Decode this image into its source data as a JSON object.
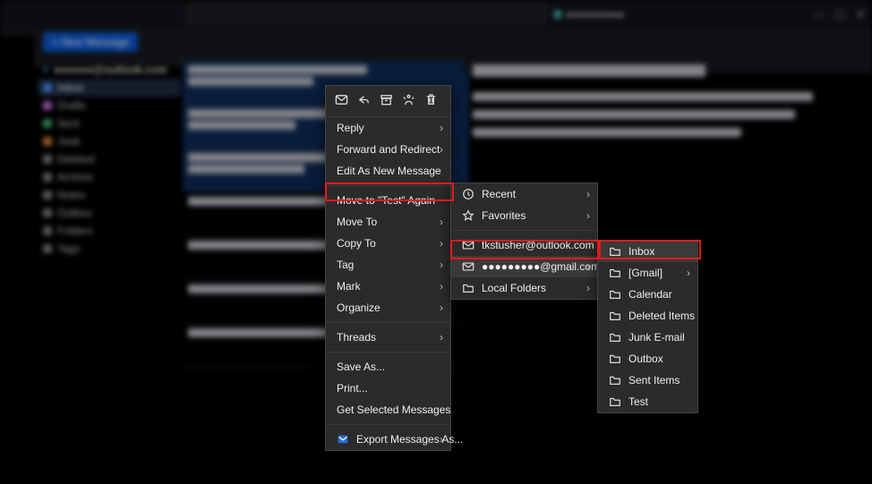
{
  "titlebar": {
    "account_label": "●●●●●●●●●"
  },
  "toolbar": {
    "new_message": "+ New Message"
  },
  "folders": {
    "account": "●●●●●●@outlook.com",
    "items": [
      {
        "label": "Inbox",
        "color": "#4b8def"
      },
      {
        "label": "Drafts",
        "color": "#c06bd9"
      },
      {
        "label": "Sent",
        "color": "#3fae6a"
      },
      {
        "label": "Junk",
        "color": "#d67a2e"
      },
      {
        "label": "Deleted",
        "color": "#7a7d84"
      },
      {
        "label": "Archive",
        "color": "#7a7d84"
      },
      {
        "label": "Notes",
        "color": "#7a7d84"
      },
      {
        "label": "Outbox",
        "color": "#7a7d84"
      },
      {
        "label": "Folders",
        "color": "#7a7d84"
      },
      {
        "label": "Tags",
        "color": "#7a7d84"
      }
    ]
  },
  "context_menu": {
    "items": [
      {
        "label": "Reply",
        "submenu": true
      },
      {
        "label": "Forward and Redirect",
        "submenu": true
      },
      {
        "label": "Edit As New Message"
      },
      {
        "sep": true
      },
      {
        "label": "Move to \"Test\" Again"
      },
      {
        "label": "Move To",
        "submenu": true,
        "highlight": true
      },
      {
        "label": "Copy To",
        "submenu": true
      },
      {
        "label": "Tag",
        "submenu": true
      },
      {
        "label": "Mark",
        "submenu": true
      },
      {
        "label": "Organize",
        "submenu": true
      },
      {
        "sep": true
      },
      {
        "label": "Threads",
        "submenu": true
      },
      {
        "sep": true
      },
      {
        "label": "Save As..."
      },
      {
        "label": "Print..."
      },
      {
        "label": "Get Selected Messages"
      },
      {
        "sep": true
      },
      {
        "label": "Export Messages As...",
        "submenu": true,
        "icon": "export"
      }
    ]
  },
  "submenu1": {
    "items": [
      {
        "label": "Recent",
        "icon": "clock",
        "submenu": true
      },
      {
        "label": "Favorites",
        "icon": "star",
        "submenu": true
      },
      {
        "sep": true
      },
      {
        "label": "tkstusher@outlook.com",
        "icon": "mail"
      },
      {
        "label": "●●●●●●●●●@gmail.com",
        "icon": "mail",
        "submenu": true,
        "hover": true,
        "highlight": true
      },
      {
        "label": "Local Folders",
        "icon": "folder",
        "submenu": true
      }
    ]
  },
  "submenu2": {
    "items": [
      {
        "label": "Inbox",
        "icon": "folder",
        "highlight": true,
        "hover": true
      },
      {
        "label": "[Gmail]",
        "icon": "folder",
        "submenu": true
      },
      {
        "label": "Calendar",
        "icon": "folder"
      },
      {
        "label": "Deleted Items",
        "icon": "folder"
      },
      {
        "label": "Junk E-mail",
        "icon": "folder"
      },
      {
        "label": "Outbox",
        "icon": "folder"
      },
      {
        "label": "Sent Items",
        "icon": "folder"
      },
      {
        "label": "Test",
        "icon": "folder"
      }
    ]
  }
}
